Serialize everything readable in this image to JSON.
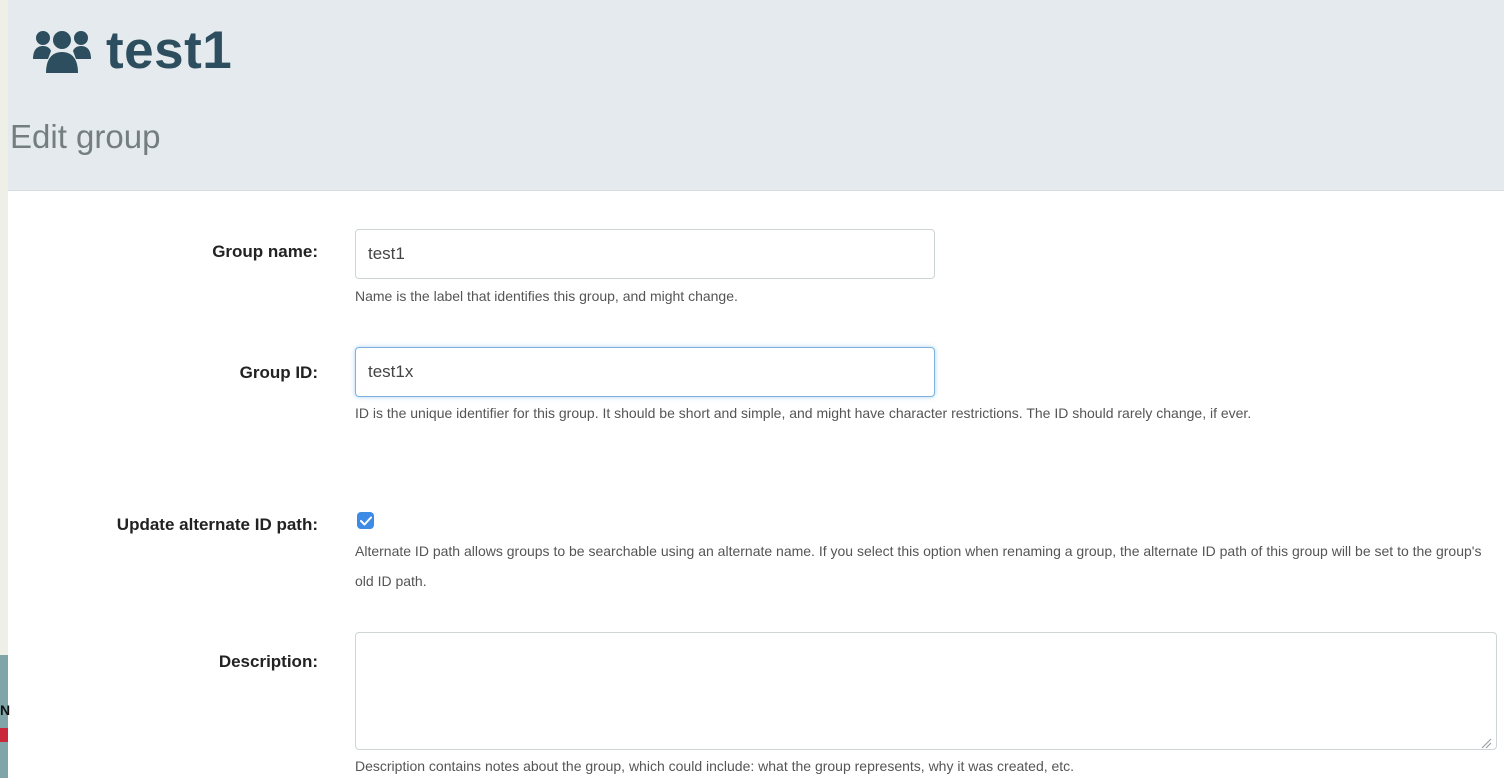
{
  "header": {
    "group_name": "test1",
    "subtitle": "Edit group",
    "icon": "users-icon"
  },
  "form": {
    "group_name": {
      "label": "Group name:",
      "value": "test1",
      "help": "Name is the label that identifies this group, and might change."
    },
    "group_id": {
      "label": "Group ID:",
      "value": "test1x",
      "help": "ID is the unique identifier for this group. It should be short and simple, and might have character restrictions. The ID should rarely change, if ever."
    },
    "update_alternate_id": {
      "label": "Update alternate ID path:",
      "checked": true,
      "help": "Alternate ID path allows groups to be searchable using an alternate name. If you select this option when renaming a group, the alternate ID path of this group will be set to the group's old ID path."
    },
    "description": {
      "label": "Description:",
      "value": "",
      "help": "Description contains notes about the group, which could include: what the group represents, why it was created, etc."
    }
  },
  "colors": {
    "header_bg": "#e4eaed",
    "title": "#2d4e5e",
    "checkbox": "#3e8be6",
    "focus_border": "#7fb1e0"
  }
}
